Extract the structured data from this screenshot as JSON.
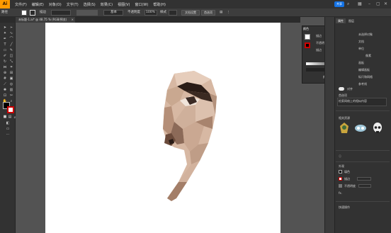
{
  "app": {
    "logo": "Ai"
  },
  "menu": {
    "items": [
      "文件(F)",
      "编辑(E)",
      "对象(O)",
      "文字(T)",
      "选择(S)",
      "效果(C)",
      "视图(V)",
      "窗口(W)",
      "帮助(H)"
    ]
  },
  "header": {
    "share_label": "共享"
  },
  "control_bar": {
    "path_label": "路径",
    "stroke_label": "描边",
    "stroke_preset": "基本",
    "opacity_label": "不透明度",
    "opacity_value": "100%",
    "style_label": "样式",
    "document_setup": "文档设置",
    "preferences": "首选项"
  },
  "document": {
    "tab_title": "未标题-1.ai* @ 48.75 % (RGB/预览)"
  },
  "float_panel": {
    "title": "颜色",
    "second_tab": "颜色参考",
    "labels": [
      "描边",
      "不透明度",
      "描边"
    ]
  },
  "right_panel": {
    "tab": "属性",
    "tab2": "图层",
    "texts": [
      "未选择对象",
      "文档",
      "单位",
      "像素",
      "画板",
      "编辑画板",
      "标尺和网格",
      "参考线",
      "对齐",
      "首选项",
      "快速操作",
      "文档设置",
      "首选项"
    ],
    "section_heading": "外观",
    "appearance_rows": [
      "填色",
      "描边",
      "不透明度"
    ],
    "search_placeholder": "检索网络上的相似内容",
    "assets_label": "相关资源",
    "bottom_label": "快速操作"
  },
  "colors": {
    "accent": "#1473e6",
    "logo_bg": "#ff9a00",
    "panel_bg": "#323232",
    "canvas_bg": "#535353",
    "artboard": "#ffffff",
    "skin_light": "#d7b8a3",
    "skin_mid": "#b58f78",
    "skin_dark": "#6a4a3a",
    "hair_dark": "#2a1c16"
  }
}
